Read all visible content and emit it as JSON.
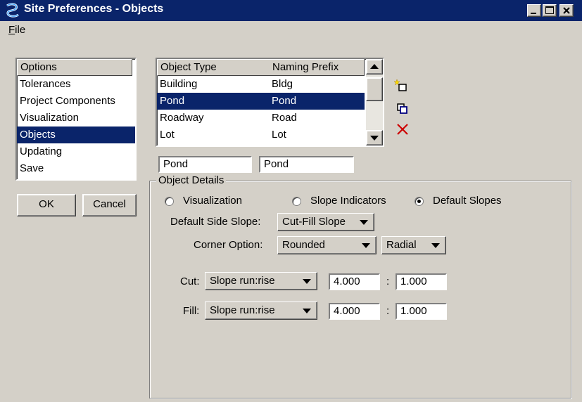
{
  "window": {
    "title": "Site Preferences - Objects",
    "minimize_icon": "minimize-icon",
    "maximize_icon": "maximize-icon",
    "close_icon": "close-icon"
  },
  "menu": {
    "file_first": "F",
    "file_rest": "ile"
  },
  "options": {
    "header": "Options",
    "items": [
      "Tolerances",
      "Project Components",
      "Visualization",
      "Objects",
      "Updating",
      "Save"
    ],
    "selected": "Objects"
  },
  "buttons": {
    "ok": "OK",
    "cancel": "Cancel"
  },
  "object_table": {
    "headers": [
      "Object Type",
      "Naming Prefix"
    ],
    "rows": [
      [
        "Building",
        "Bldg"
      ],
      [
        "Pond",
        "Pond"
      ],
      [
        "Roadway",
        "Road"
      ],
      [
        "Lot",
        "Lot"
      ]
    ],
    "selected": "Pond"
  },
  "edit_fields": {
    "object_type": "Pond",
    "naming_prefix": "Pond"
  },
  "tools": [
    "new-item-icon",
    "copy-icon",
    "delete-icon"
  ],
  "details": {
    "title": "Object Details",
    "radios": [
      "Visualization",
      "Slope Indicators",
      "Default Slopes"
    ],
    "selected_radio": "Default Slopes",
    "side_slope_label": "Default Side Slope:",
    "side_slope_value": "Cut-Fill Slope",
    "corner_label": "Corner Option:",
    "corner_value": "Rounded",
    "corner_type": "Radial",
    "cut_label": "Cut:",
    "cut_method": "Slope run:rise",
    "cut_run": "4.000",
    "cut_rise": "1.000",
    "fill_label": "Fill:",
    "fill_method": "Slope run:rise",
    "fill_run": "4.000",
    "fill_rise": "1.000",
    "ratio_sep": ":"
  },
  "colors": {
    "titlebar": "#0a246a",
    "selection": "#0a246a",
    "face": "#d4d0c8",
    "delete": "#cc0000"
  }
}
